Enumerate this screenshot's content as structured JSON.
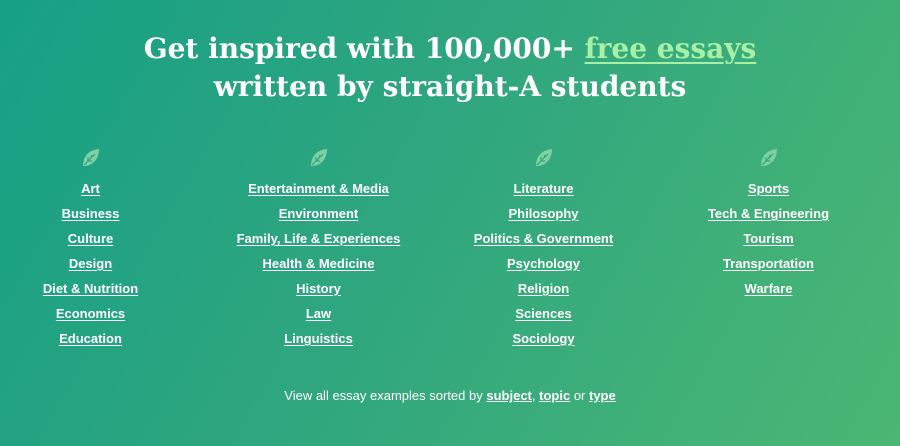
{
  "hero": {
    "line1_prefix": "Get inspired with 100,000+",
    "line1_highlight": "free essays",
    "line2": "written by straight-A students"
  },
  "icons": {
    "column_icon": "leaf-icon",
    "icon_color": "#7fd1a4"
  },
  "columns": [
    {
      "items": [
        "Art",
        "Business",
        "Culture",
        "Design",
        "Diet & Nutrition",
        "Economics",
        "Education"
      ]
    },
    {
      "items": [
        "Entertainment & Media",
        "Environment",
        "Family, Life & Experiences",
        "Health & Medicine",
        "History",
        "Law",
        "Linguistics"
      ]
    },
    {
      "items": [
        "Literature",
        "Philosophy",
        "Politics & Government",
        "Psychology",
        "Religion",
        "Sciences",
        "Sociology"
      ]
    },
    {
      "items": [
        "Sports",
        "Tech & Engineering",
        "Tourism",
        "Transportation",
        "Warfare"
      ]
    }
  ],
  "footer": {
    "prefix": "View all essay examples sorted by",
    "link_subject": "subject",
    "sep1": ",",
    "link_topic": "topic",
    "sep2": "or",
    "link_type": "type"
  },
  "colors": {
    "gradient_start": "#17a086",
    "gradient_end": "#4cb774",
    "highlight": "#a7f0a6",
    "text": "#ffffff"
  }
}
